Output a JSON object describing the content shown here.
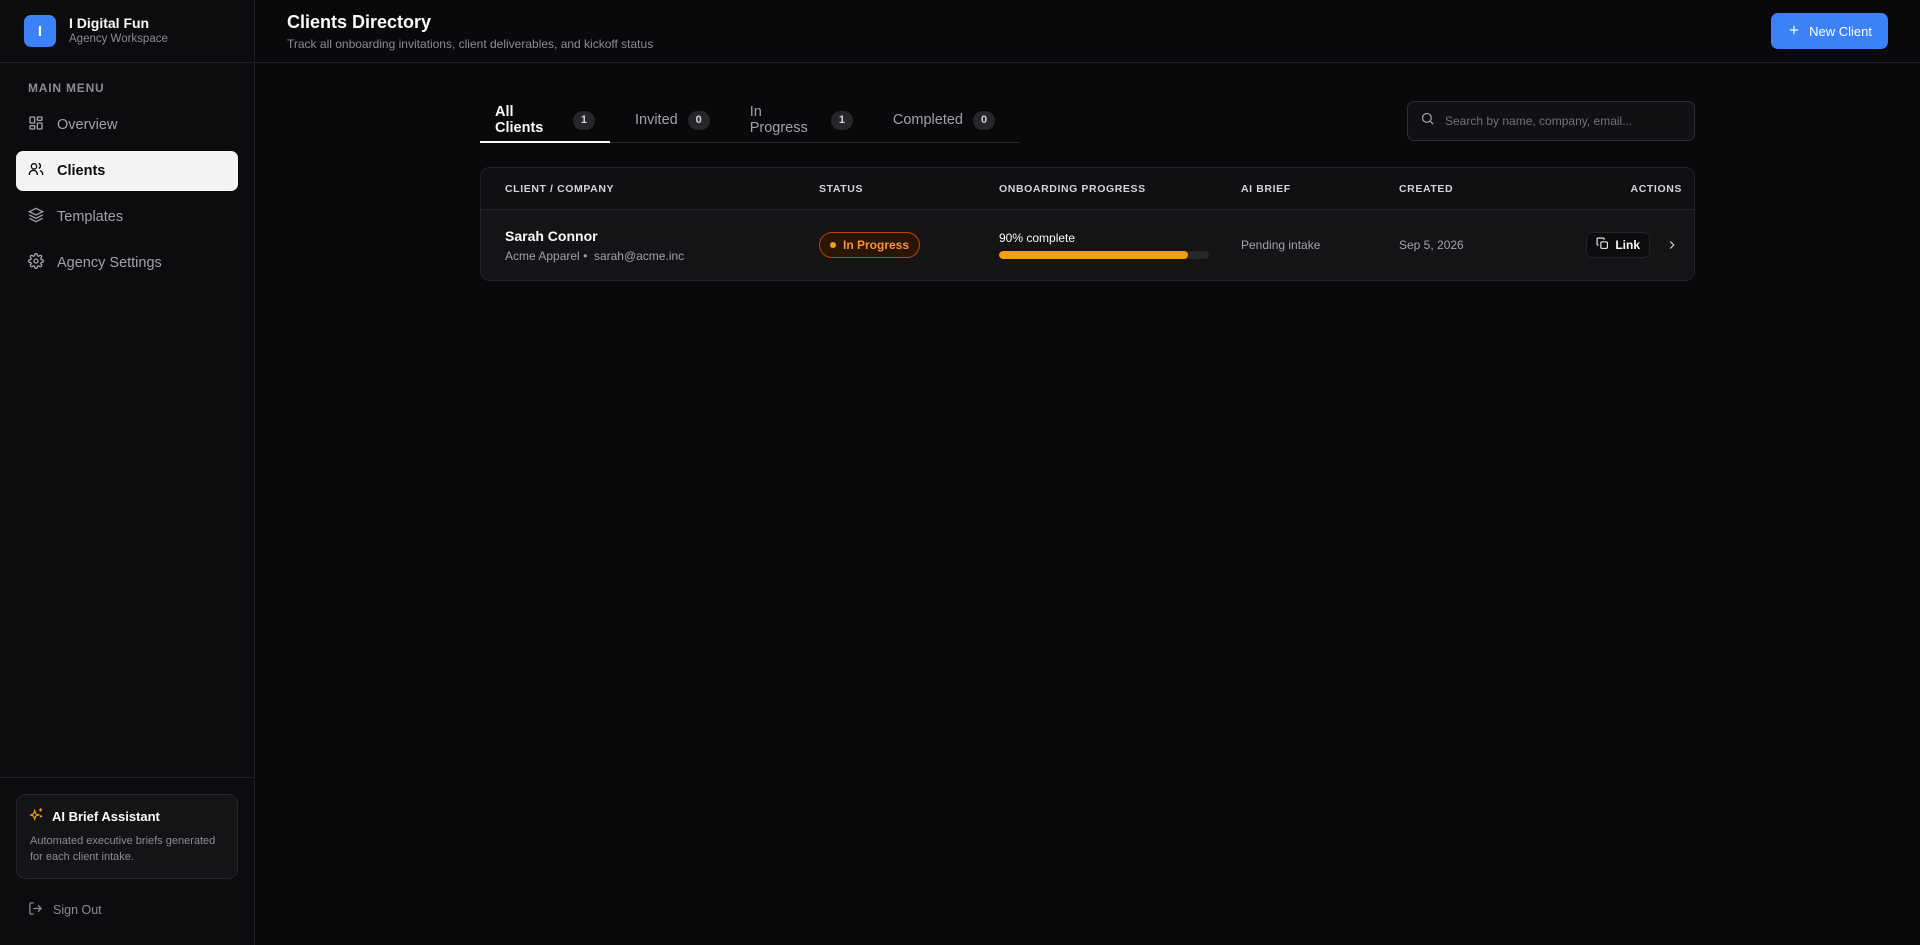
{
  "brand": {
    "initial": "I",
    "name": "I Digital Fun",
    "subtitle": "Agency Workspace",
    "color": "#3b82f6"
  },
  "sidebar": {
    "menu_title": "MAIN MENU",
    "items": [
      {
        "label": "Overview",
        "icon": "grid-icon",
        "active": false
      },
      {
        "label": "Clients",
        "icon": "users-icon",
        "active": true
      },
      {
        "label": "Templates",
        "icon": "layers-icon",
        "active": false
      },
      {
        "label": "Agency Settings",
        "icon": "gear-icon",
        "active": false
      }
    ],
    "ai_card": {
      "title": "AI Brief Assistant",
      "description": "Automated executive briefs generated for each client intake."
    },
    "sign_out": "Sign Out"
  },
  "header": {
    "title": "Clients Directory",
    "subtitle": "Track all onboarding invitations, client deliverables, and kickoff status",
    "new_client_label": "New Client"
  },
  "tabs": [
    {
      "label": "All Clients",
      "count": "1",
      "active": true
    },
    {
      "label": "Invited",
      "count": "0",
      "active": false
    },
    {
      "label": "In Progress",
      "count": "1",
      "active": false
    },
    {
      "label": "Completed",
      "count": "0",
      "active": false
    }
  ],
  "search": {
    "placeholder": "Search by name, company, email..."
  },
  "table": {
    "columns": [
      "CLIENT / COMPANY",
      "STATUS",
      "ONBOARDING PROGRESS",
      "AI BRIEF",
      "CREATED",
      "ACTIONS"
    ],
    "rows": [
      {
        "name": "Sarah Connor",
        "company": "Acme Apparel",
        "email": "sarah@acme.inc",
        "status": "In Progress",
        "progress_label": "90% complete",
        "progress": 0.9,
        "ai_brief": "Pending intake",
        "created": "Sep 5, 2026",
        "link_label": "Link"
      }
    ]
  },
  "colors": {
    "accent": "#3b82f6",
    "progress": "#f59e0b",
    "status_in_progress": "#fb923c"
  }
}
